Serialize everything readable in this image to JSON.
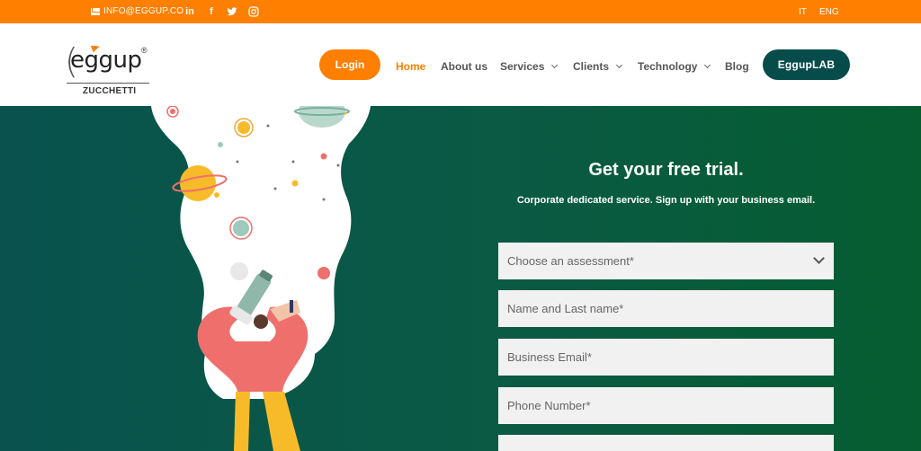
{
  "topbar": {
    "email": "INFO@EGGUP.CO",
    "social": [
      {
        "icon": "linkedin-icon",
        "glyph": "in"
      },
      {
        "icon": "facebook-icon",
        "glyph": "f"
      },
      {
        "icon": "twitter-icon",
        "glyph": ""
      },
      {
        "icon": "instagram-icon",
        "glyph": ""
      }
    ],
    "languages": [
      "IT",
      "ENG"
    ]
  },
  "header": {
    "logo": {
      "word": "eggup",
      "reg": "®",
      "sub": "ZUCCHETTI"
    },
    "login_label": "Login",
    "nav": [
      {
        "label": "Home",
        "active": true,
        "dropdown": false
      },
      {
        "label": "About us",
        "active": false,
        "dropdown": false
      },
      {
        "label": "Services",
        "active": false,
        "dropdown": true
      },
      {
        "label": "Clients",
        "active": false,
        "dropdown": true
      },
      {
        "label": "Technology",
        "active": false,
        "dropdown": true
      },
      {
        "label": "Blog",
        "active": false,
        "dropdown": false
      }
    ],
    "lab_label": "EggupLAB"
  },
  "form": {
    "title": "Get your free trial.",
    "subtitle": "Corporate dedicated service. Sign up with your business email.",
    "assessment_placeholder": "Choose an assessment*",
    "name_placeholder": "Name and Last name*",
    "email_placeholder": "Business Email*",
    "phone_placeholder": "Phone Number*"
  },
  "colors": {
    "orange": "#ff7f00",
    "dark_teal": "#064c4a",
    "hero_green": "#0a5a44",
    "coral": "#ef6f6c",
    "yellow": "#f7bb2a"
  }
}
